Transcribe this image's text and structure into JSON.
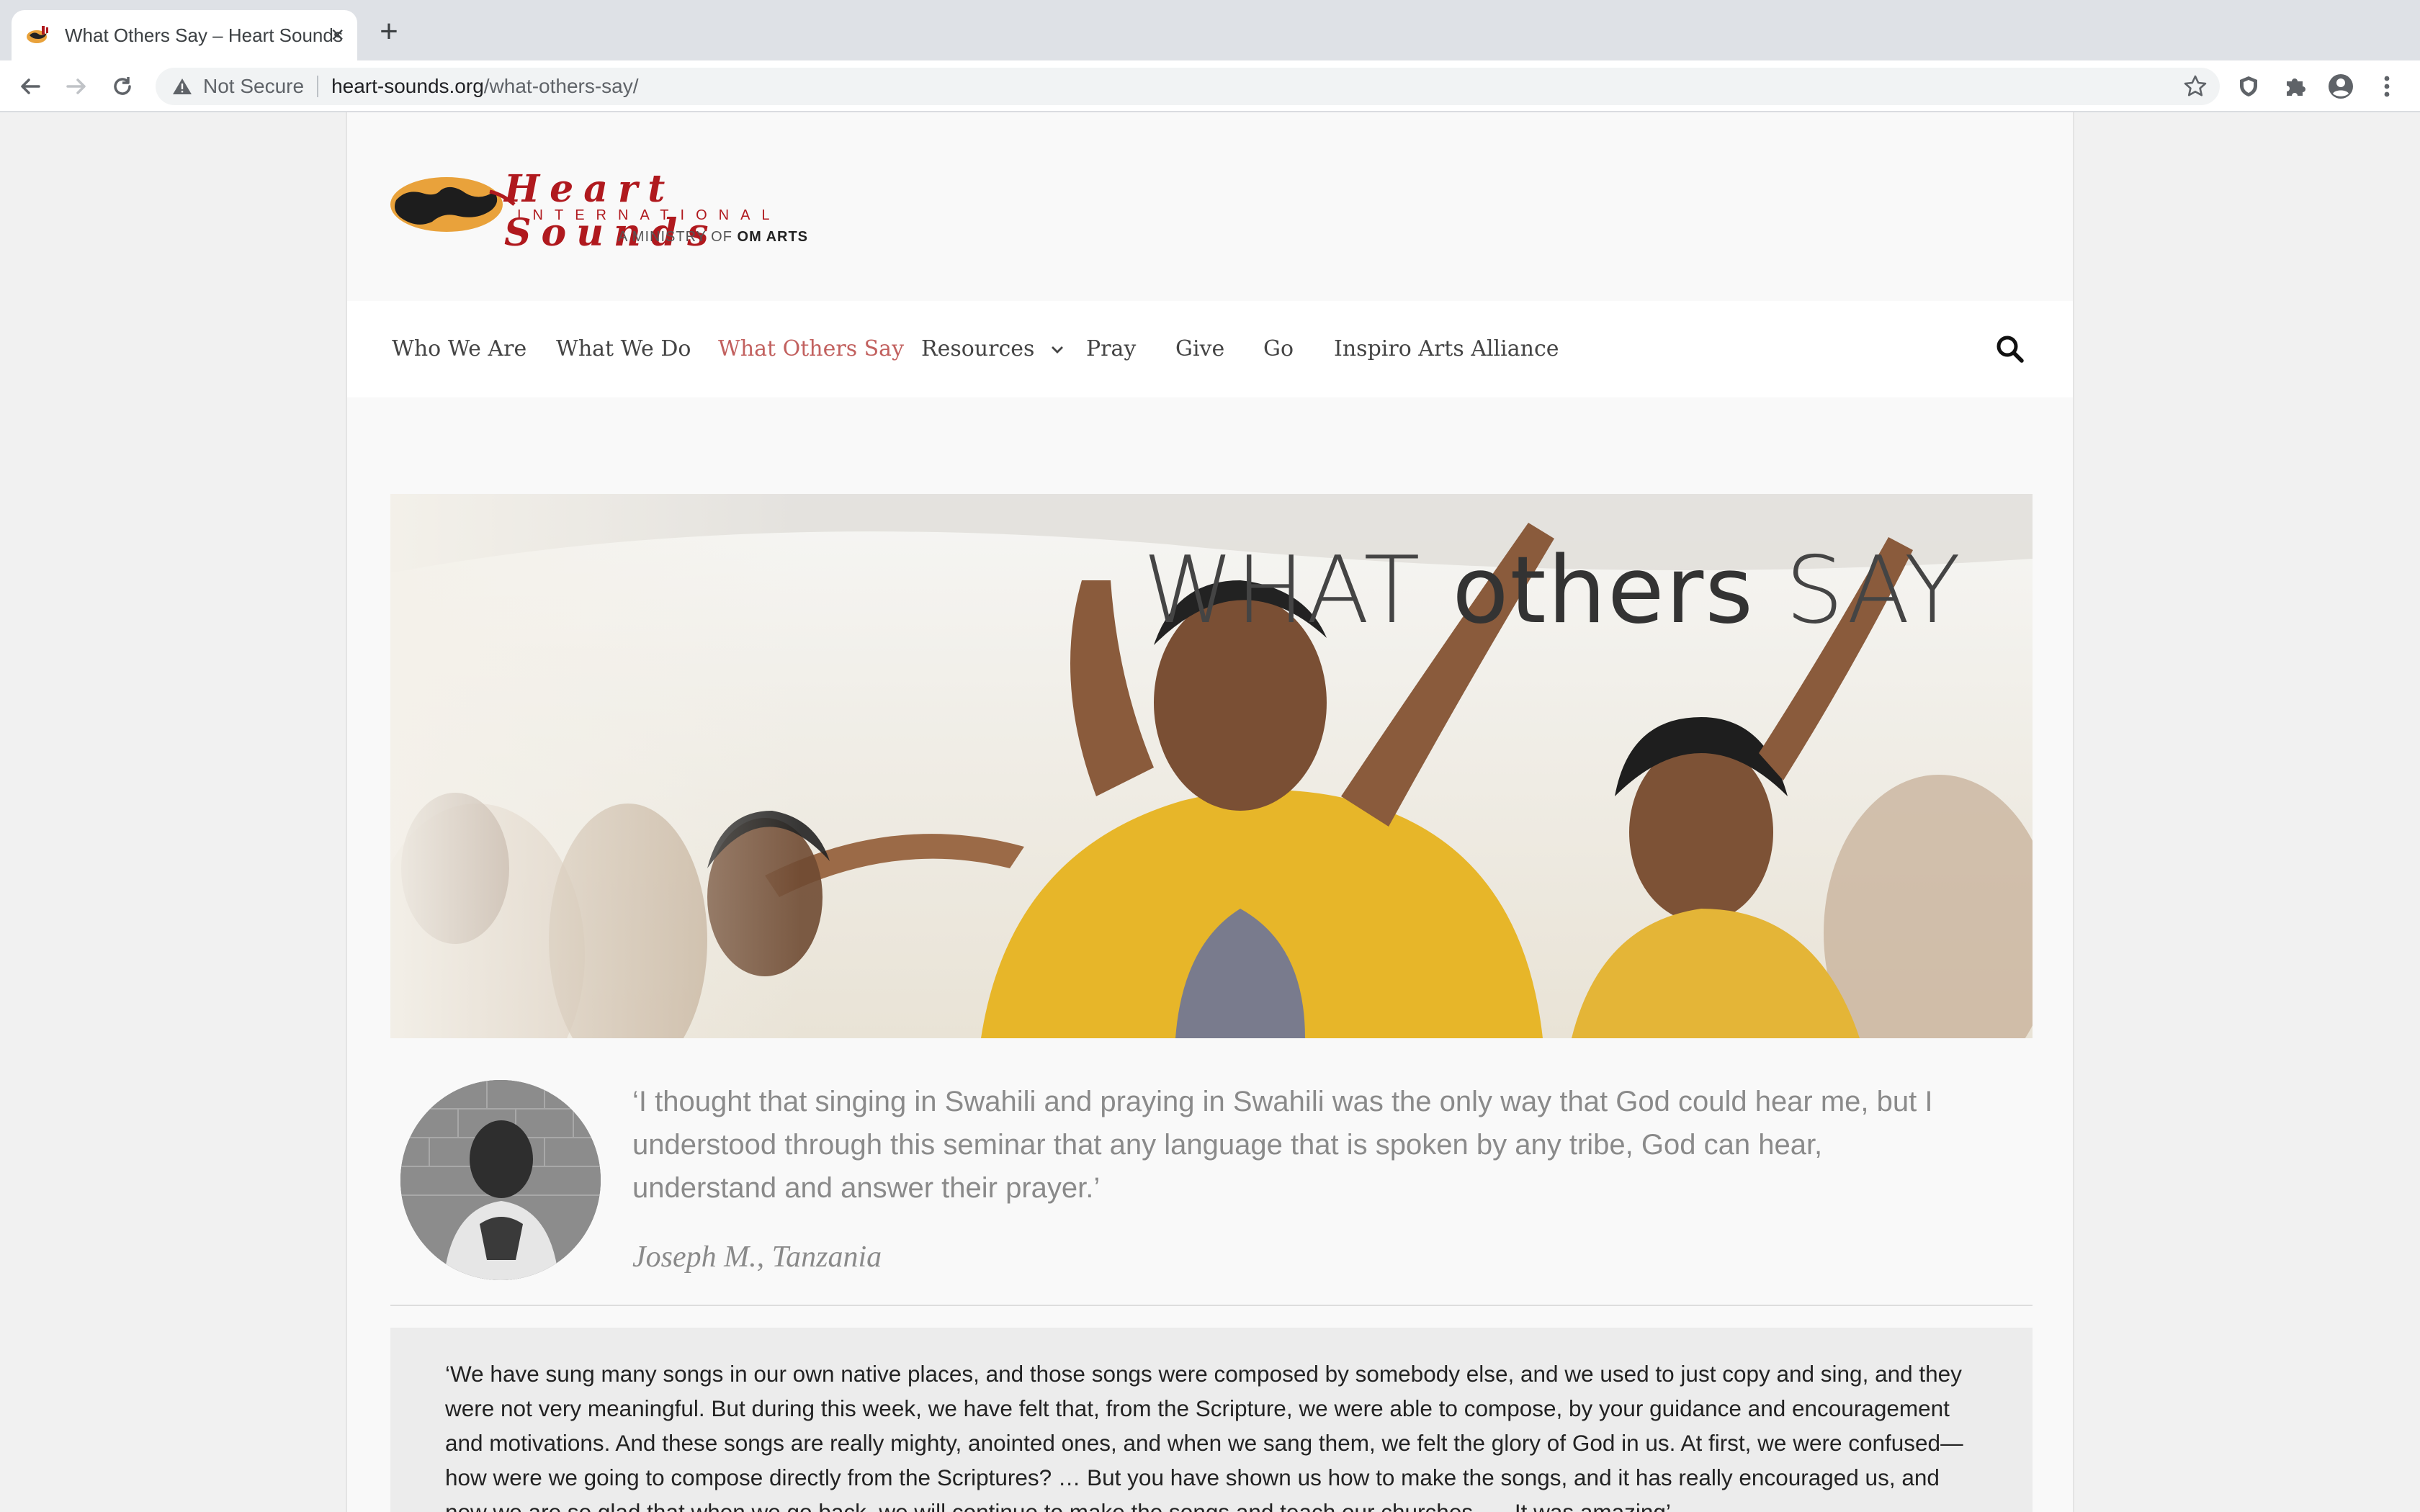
{
  "browser": {
    "tab_title": "What Others Say – Heart Sounds International",
    "security_label": "Not Secure",
    "url_host": "heart-sounds.org",
    "url_path": "/what-others-say/"
  },
  "site": {
    "logo_title": "Heart Sounds",
    "logo_subtitle": "INTERNATIONAL",
    "logo_ministry_prefix": "A MINISTRY OF",
    "logo_ministry_name": "OM ARTS"
  },
  "nav": {
    "items": [
      {
        "label": "Who We Are"
      },
      {
        "label": "What We Do"
      },
      {
        "label": "What Others Say"
      },
      {
        "label": "Resources"
      },
      {
        "label": "Pray"
      },
      {
        "label": "Give"
      },
      {
        "label": "Go"
      },
      {
        "label": "Inspiro Arts Alliance"
      }
    ],
    "active": "What Others Say"
  },
  "hero": {
    "title_part1": "WHAT",
    "title_part2": "others",
    "title_part3": "SAY"
  },
  "testimonial": {
    "quote": "‘I thought that singing in Swahili and praying in Swahili was the only way that God could hear me, but I understood through this seminar that any language that is spoken by any tribe, God can hear, understand and answer their prayer.’",
    "author": "Joseph M., Tanzania"
  },
  "quote_block": {
    "text": "‘We have sung many songs in our own native places, and those songs were composed by somebody else, and we used to just copy and sing, and they were not very meaningful. But during this week, we have felt that, from the Scripture, we were able to compose, by your guidance and encouragement and motivations. And these songs are really mighty, anointed ones, and when we sang them, we felt the glory of God in us. At first, we were confused—how were we going to compose directly from the Scriptures? … But you have shown us how to make the songs, and it has really encouraged us, and now we are so glad that when we go back, we will continue to make the songs and teach our churches. … It was amazing’"
  },
  "colors": {
    "accent": "#c2615f",
    "logo_red": "#b0191e"
  }
}
